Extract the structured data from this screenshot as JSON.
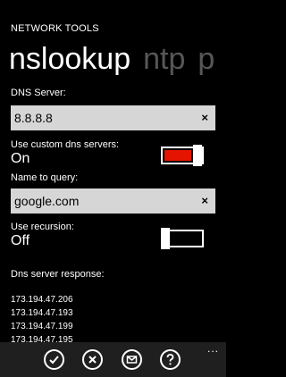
{
  "app": {
    "title": "NETWORK TOOLS"
  },
  "pivot": {
    "items": [
      "nslookup",
      "ntp",
      "p"
    ]
  },
  "dns_server": {
    "label": "DNS Server:",
    "value": "8.8.8.8",
    "clear_glyph": "×"
  },
  "custom_dns": {
    "label": "Use custom dns servers:",
    "state": "On",
    "on": true
  },
  "query": {
    "label": "Name to query:",
    "value": "google.com",
    "clear_glyph": "×"
  },
  "recursion": {
    "label": "Use recursion:",
    "state": "Off",
    "on": false
  },
  "response": {
    "label": "Dns server response:",
    "lines": [
      "173.194.47.206",
      "173.194.47.193",
      "173.194.47.199",
      "173.194.47.195"
    ]
  },
  "appbar": {
    "buttons": [
      "check-icon",
      "cancel-icon",
      "mail-icon",
      "help-icon"
    ],
    "more_glyph": "..."
  },
  "colors": {
    "accent": "#e51400",
    "background": "#000000",
    "textbox": "#d6d6d6",
    "appbar": "#1f1f1f"
  }
}
